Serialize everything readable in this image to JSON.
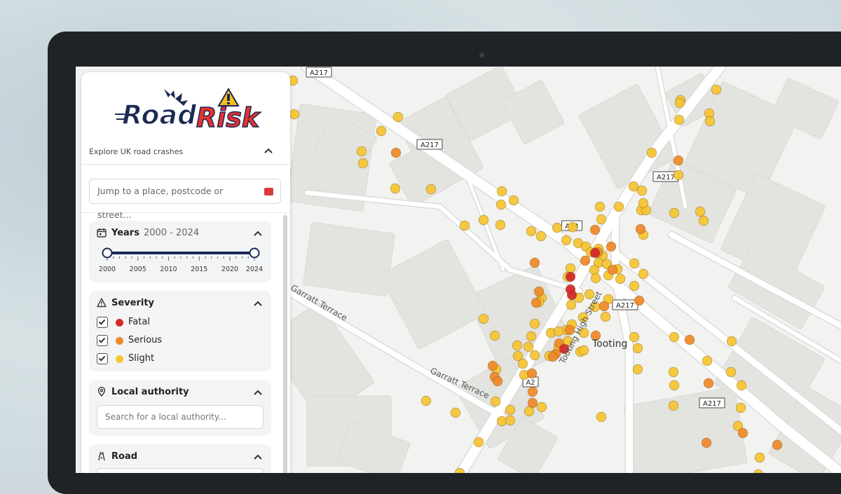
{
  "app": {
    "logo_text_1": "Road",
    "logo_text_2": "Risk",
    "tagline": "Explore UK road crashes"
  },
  "search": {
    "placeholder": "Jump to a place, postcode or street..."
  },
  "filters": {
    "years": {
      "title": "Years",
      "range_label": "2000 - 2024",
      "min": 2000,
      "max": 2024,
      "selected": [
        2000,
        2024
      ],
      "ticks": [
        "2000",
        "2005",
        "2010",
        "2015",
        "2020",
        "2024"
      ]
    },
    "severity": {
      "title": "Severity",
      "options": [
        {
          "label": "Fatal",
          "checked": true,
          "color": "#d42a2a"
        },
        {
          "label": "Serious",
          "checked": true,
          "color": "#ee8a2c"
        },
        {
          "label": "Slight",
          "checked": true,
          "color": "#f5c535"
        }
      ]
    },
    "local_authority": {
      "title": "Local authority",
      "placeholder": "Search for a local authority..."
    },
    "road": {
      "title": "Road"
    }
  },
  "map": {
    "place_label": "Tooting",
    "street_labels": [
      "Garratt Terrace",
      "Garratt Terrace",
      "Tooting High Street"
    ],
    "road_shields": [
      "A217",
      "A217",
      "A217",
      "A24",
      "A217",
      "A217",
      "A2"
    ],
    "colors": {
      "fatal": "#d42a2a",
      "serious": "#ee8a2c",
      "slight": "#f5c535",
      "building": "#e3e3e0",
      "road": "#ffffff",
      "background": "#f2f2f0"
    }
  }
}
